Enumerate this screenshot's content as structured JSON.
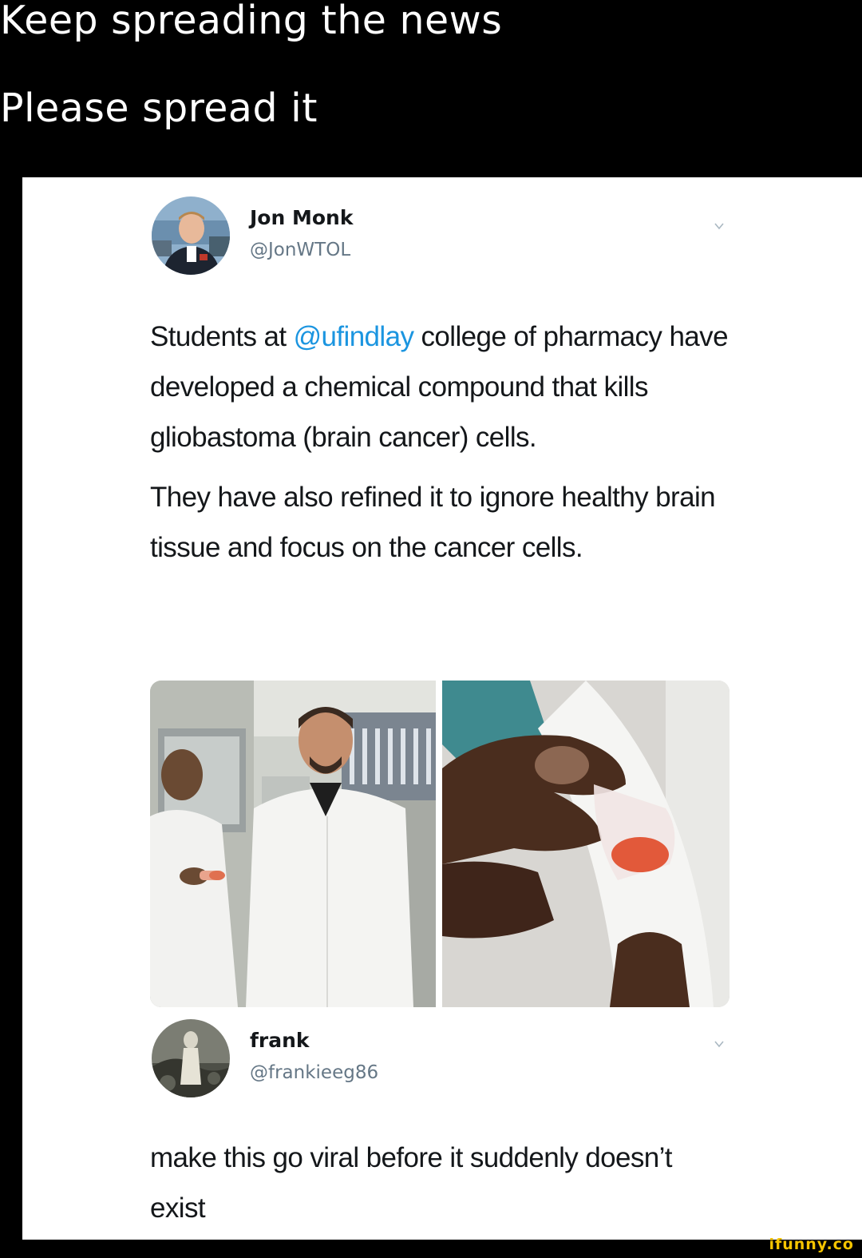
{
  "meme": {
    "line1": "Keep spreading the news",
    "line2": "Please spread it"
  },
  "tweet": {
    "name": "Jon Monk",
    "handle": "@JonWTOL",
    "p1_before": "Students at ",
    "p1_mention": "@ufindlay",
    "p1_after": " college of pharmacy have developed a chemical compound that kills gliobastoma (brain cancer) cells.",
    "p2": "They have also refined it to ignore healthy brain tissue and focus on the cancer cells."
  },
  "reply": {
    "name": "frank",
    "handle": "@frankieeg86",
    "text": "make this go viral before it suddenly doesn’t exist"
  },
  "watermark": "ifunny.co",
  "colors": {
    "mention": "#1b95e0",
    "handle": "#657786",
    "text": "#14171a",
    "background": "#000000",
    "card": "#ffffff",
    "watermark": "#f5c400"
  },
  "icons": [
    "chevron-down-icon"
  ]
}
